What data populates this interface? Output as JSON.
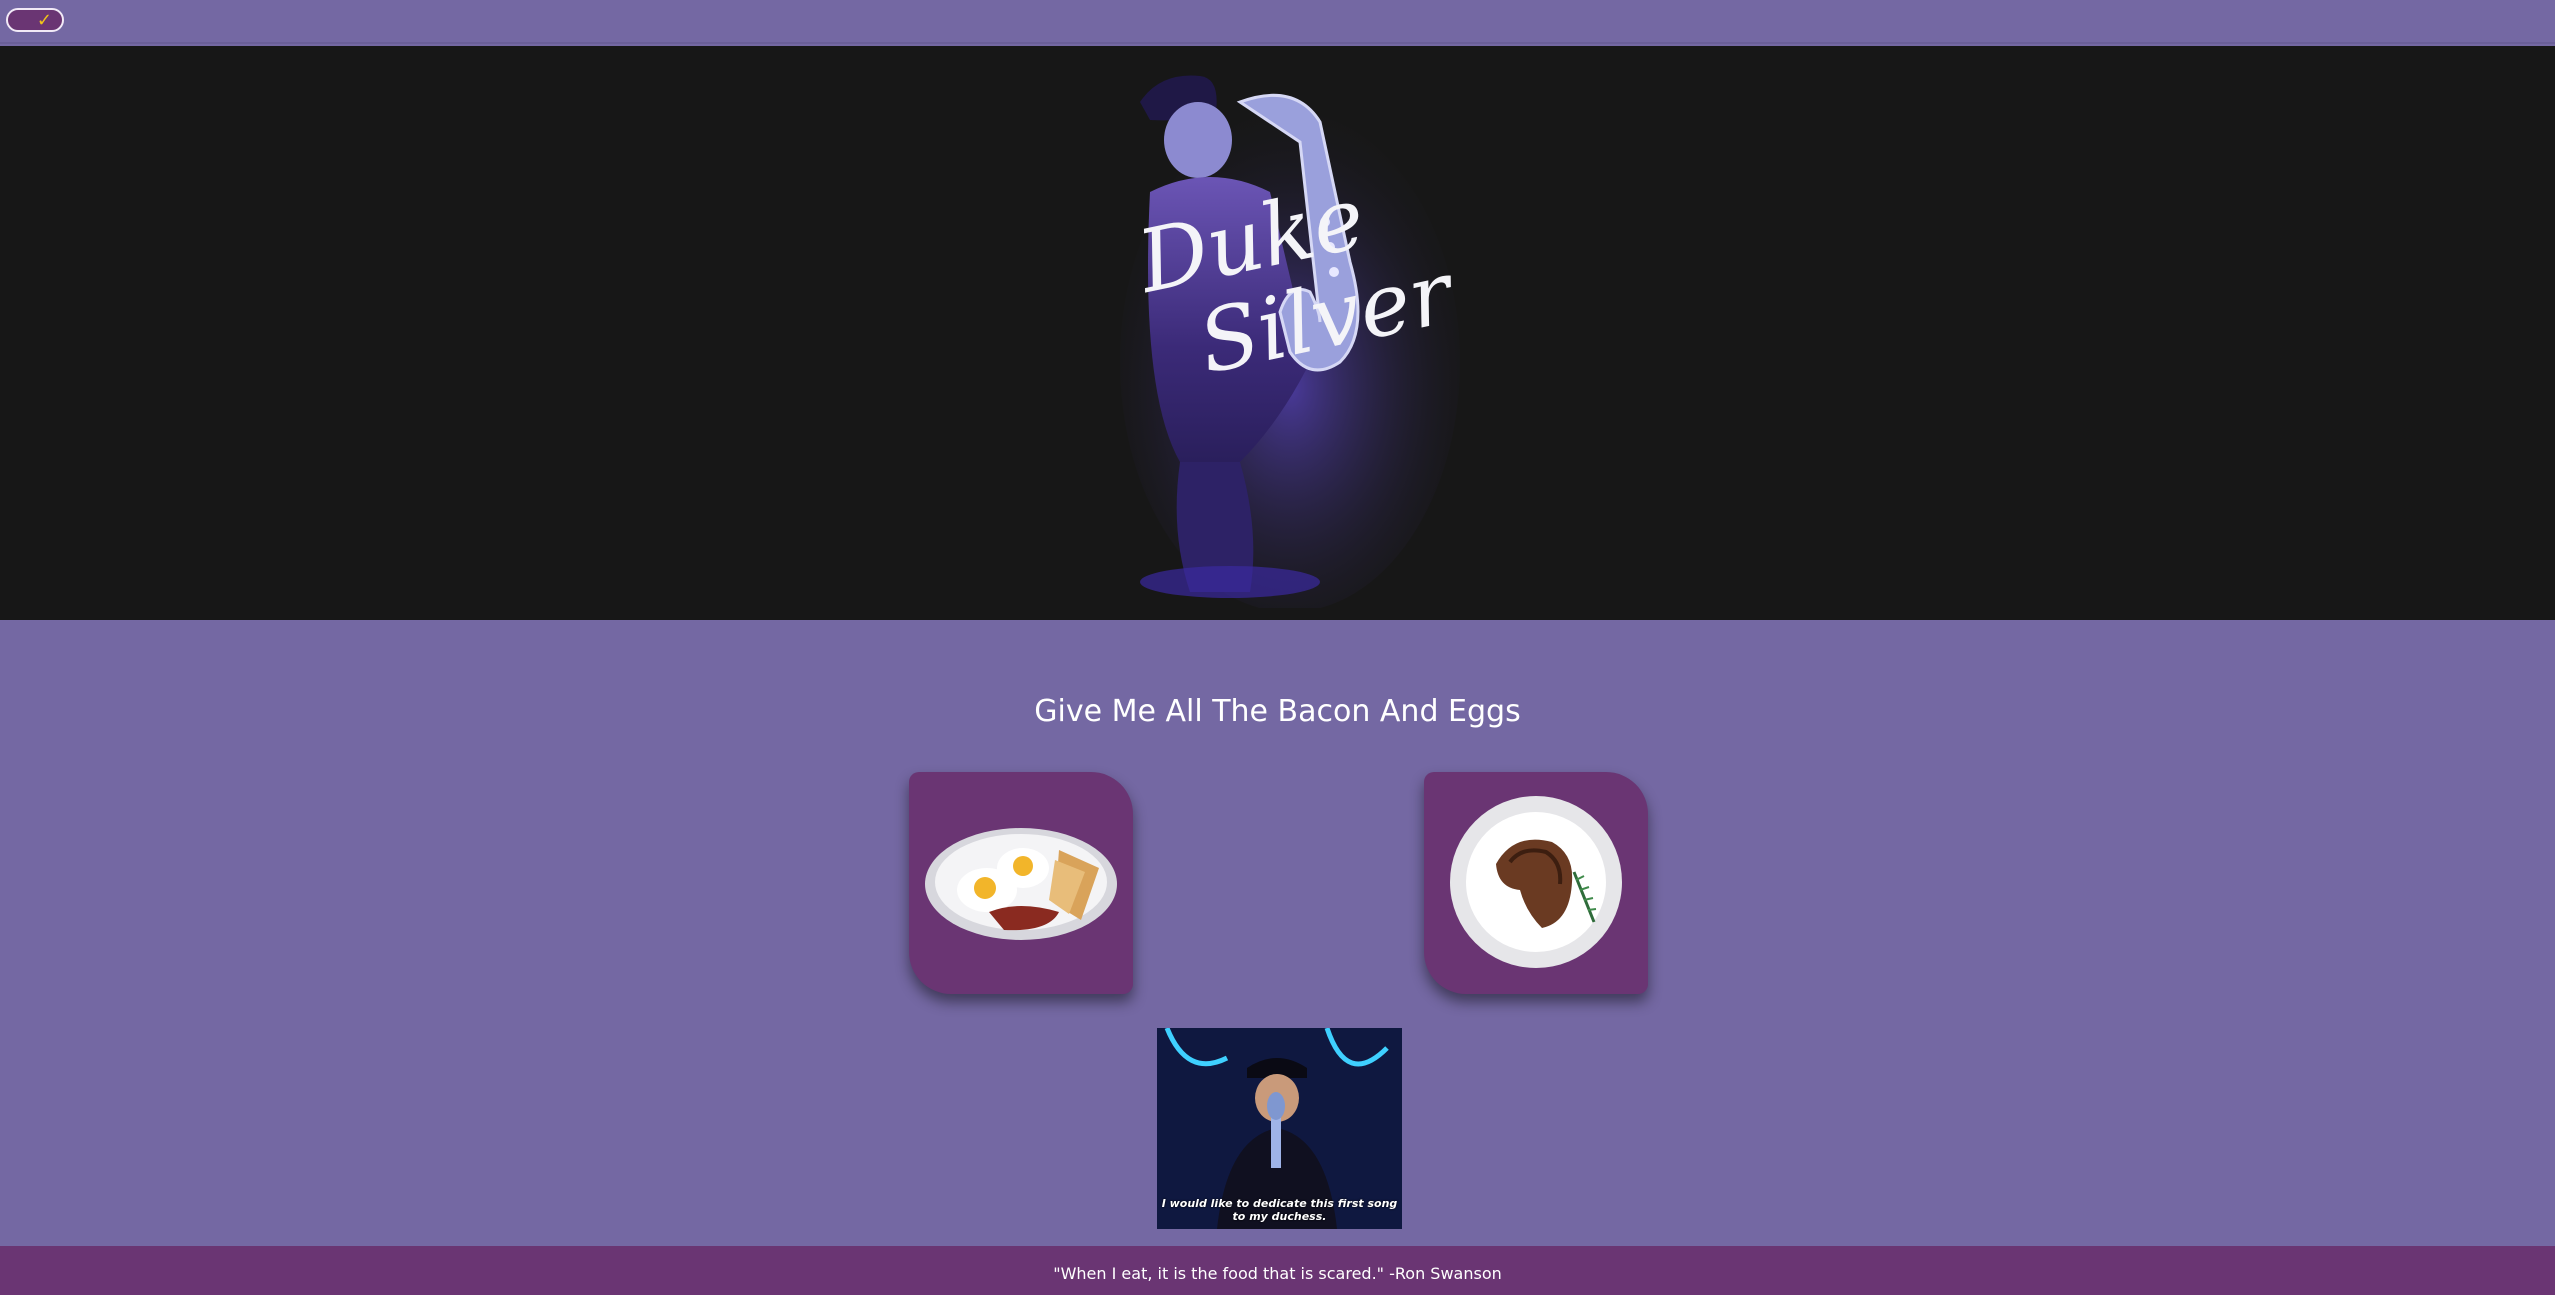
{
  "colors": {
    "page_bg": "#7468a3",
    "hero_bg": "#171717",
    "tile_bg": "#6a3573",
    "footer_bg": "#6a3573",
    "toggle_check": "#f0c419"
  },
  "toggle": {
    "icon": "check-icon",
    "glyph": "✓"
  },
  "hero": {
    "logo_text_line1": "Duke",
    "logo_text_line2": "Silver"
  },
  "main": {
    "heading": "Give Me All The Bacon And Eggs",
    "tiles": [
      {
        "name": "bacon-and-eggs-plate",
        "icon": "breakfast-plate-image"
      },
      {
        "name": "steak-plate",
        "icon": "steak-plate-image"
      }
    ],
    "gif_caption": "I would like to dedicate this first song to my duchess."
  },
  "footer": {
    "quote": "\"When I eat, it is the food that is scared.\" -Ron Swanson"
  }
}
